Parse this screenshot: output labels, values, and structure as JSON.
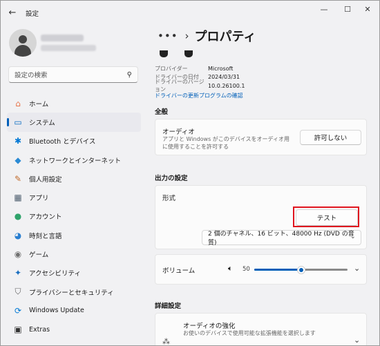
{
  "window": {
    "app_title": "設定",
    "back_icon": "arrow-left-icon",
    "controls": [
      "minimize-icon",
      "maximize-icon",
      "close-icon"
    ]
  },
  "search": {
    "placeholder": "設定の検索"
  },
  "sidebar": {
    "items": [
      {
        "label": "ホーム",
        "icon": "home-icon",
        "glyph": "⌂",
        "color": "#e8734a"
      },
      {
        "label": "システム",
        "icon": "system-icon",
        "glyph": "▭",
        "color": "#0067c0",
        "active": true
      },
      {
        "label": "Bluetooth とデバイス",
        "icon": "bluetooth-icon",
        "glyph": "✱",
        "color": "#0078d4"
      },
      {
        "label": "ネットワークとインターネット",
        "icon": "network-icon",
        "glyph": "◆",
        "color": "#2a8ad4"
      },
      {
        "label": "個人用設定",
        "icon": "brush-icon",
        "glyph": "✎",
        "color": "#c06a2b"
      },
      {
        "label": "アプリ",
        "icon": "apps-icon",
        "glyph": "▦",
        "color": "#506070"
      },
      {
        "label": "アカウント",
        "icon": "account-icon",
        "glyph": "●",
        "color": "#2fa36b"
      },
      {
        "label": "時刻と言語",
        "icon": "time-language-icon",
        "glyph": "◕",
        "color": "#2a7fd0"
      },
      {
        "label": "ゲーム",
        "icon": "game-icon",
        "glyph": "◉",
        "color": "#707070"
      },
      {
        "label": "アクセシビリティ",
        "icon": "accessibility-icon",
        "glyph": "✦",
        "color": "#1a6fc0"
      },
      {
        "label": "プライバシーとセキュリティ",
        "icon": "shield-icon",
        "glyph": "⛉",
        "color": "#606060"
      },
      {
        "label": "Windows Update",
        "icon": "windows-update-icon",
        "glyph": "⟳",
        "color": "#0078d4"
      },
      {
        "label": "Extras",
        "icon": "extras-icon",
        "glyph": "▣",
        "color": "#333333"
      }
    ]
  },
  "breadcrumb": {
    "dots": "•••",
    "sep": "›",
    "title": "プロパティ"
  },
  "properties": {
    "rows": [
      {
        "key": "プロバイダー",
        "value": "Microsoft"
      },
      {
        "key": "ドライバーの日付",
        "value": "2024/03/31"
      },
      {
        "key": "ドライバーのバージョン",
        "value": "10.0.26100.1"
      }
    ],
    "update_link": "ドライバーの更新プログラムの確認"
  },
  "general": {
    "heading": "全般",
    "audio_title": "オーディオ",
    "audio_desc": "アプリと Windows がこのデバイスをオーディオ用に使用することを許可する",
    "deny_button": "許可しない"
  },
  "output": {
    "heading": "出力の設定",
    "format_label": "形式",
    "test_button": "テスト",
    "format_value": "2 個のチャネル、16 ビット、48000 Hz (DVD の音質)",
    "volume_label": "ボリューム",
    "volume_value": "50",
    "volume_level": 0.5,
    "speaker_icon": "speaker-icon"
  },
  "advanced": {
    "heading": "詳細設定",
    "enhance_title": "オーディオの強化",
    "enhance_desc": "お使いのデバイスで使用可能な拡張機能を選択します",
    "enhance_icon": "sparkle-icon"
  },
  "colors": {
    "accent": "#005fb8",
    "highlight": "#e0141e"
  }
}
